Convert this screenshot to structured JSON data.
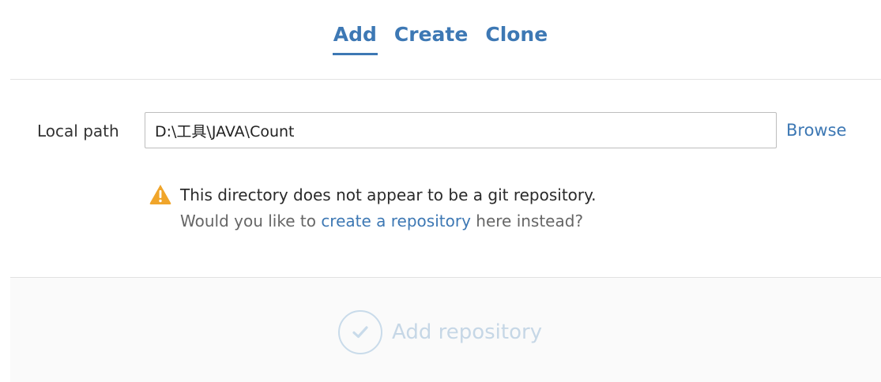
{
  "tabs": [
    {
      "label": "Add",
      "active": true
    },
    {
      "label": "Create",
      "active": false
    },
    {
      "label": "Clone",
      "active": false
    }
  ],
  "form": {
    "path_label": "Local path",
    "path_value": "D:\\工具\\JAVA\\Count",
    "browse_label": "Browse"
  },
  "warning": {
    "icon": "warning-triangle-icon",
    "message": "This directory does not appear to be a git repository.",
    "prompt_before": "Would you like to ",
    "prompt_link": "create a repository",
    "prompt_after": " here instead?"
  },
  "footer": {
    "add_label": "Add repository",
    "add_enabled": false,
    "icon": "checkmark-circle-icon"
  },
  "colors": {
    "accent": "#3d78b4",
    "warning": "#f0a52a",
    "disabled": "#c6d7e6"
  }
}
